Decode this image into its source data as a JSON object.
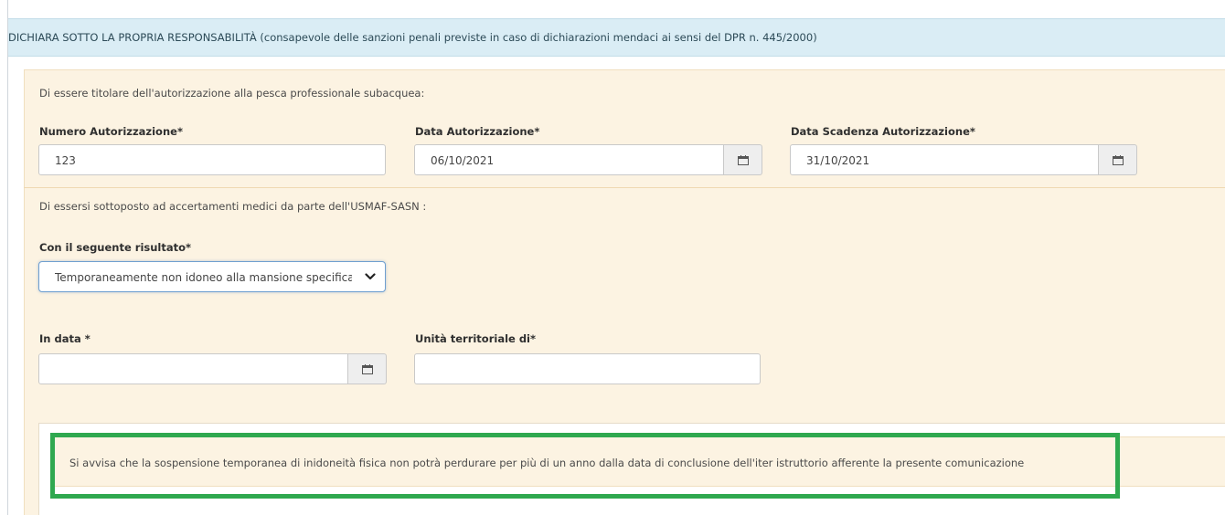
{
  "header": {
    "text": "DICHIARA SOTTO LA PROPRIA RESPONSABILITÀ (consapevole delle sanzioni penali previste in caso di dichiarazioni mendaci ai sensi del DPR n. 445/2000)"
  },
  "authorization": {
    "intro": "Di essere titolare dell'autorizzazione alla pesca professionale subacquea:",
    "numero": {
      "label": "Numero Autorizzazione*",
      "value": "123"
    },
    "data": {
      "label": "Data Autorizzazione*",
      "value": "06/10/2021"
    },
    "scadenza": {
      "label": "Data Scadenza Autorizzazione*",
      "value": "31/10/2021"
    }
  },
  "medical": {
    "intro": "Di essersi sottoposto ad accertamenti medici da parte dell'USMAF-SASN :",
    "risultato": {
      "label": "Con il seguente risultato*",
      "selected": "Temporaneamente non idoneo alla mansione specifica"
    },
    "in_data": {
      "label": "In data *",
      "value": ""
    },
    "unita": {
      "label": "Unità territoriale di*",
      "value": ""
    }
  },
  "notice": {
    "text": "Si avvisa che la sospensione temporanea di inidoneità fisica non potrà perdurare per più di un anno dalla data di conclusione dell'iter istruttorio afferente la presente comunicazione"
  },
  "icons": {
    "calendar": "calendar-icon",
    "chevron": "chevron-down-icon"
  },
  "colors": {
    "header_bg": "#daedf5",
    "panel_bg": "#fcf3e2",
    "highlight": "#2fa84f"
  }
}
